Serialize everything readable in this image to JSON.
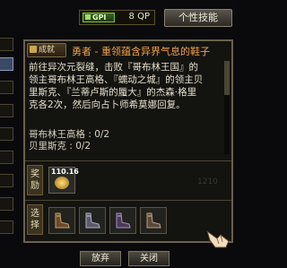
{
  "topbar": {
    "currency_badge": "GPI",
    "currency_amount": "8 QP",
    "skill_button": "个性技能"
  },
  "quest": {
    "tag": "成就",
    "title": "勇者 - 重领蕴含异界气息的鞋子",
    "description_lines": [
      "    前往异次元裂缝，击败『哥布林王国』的",
      "领主哥布林王高格、『蠕动之城』的领主贝",
      "里斯克、『兰蒂卢斯的蜃大』的杰森·格里",
      "克各2次，然后向占卜师希莫娜回复。"
    ],
    "objectives": [
      "哥布林王高格 : 0/2",
      "贝里斯克 : 0/2"
    ]
  },
  "rewards": {
    "label": "奖励",
    "item_qty": "110.16",
    "faint_text": "1210"
  },
  "choose": {
    "label": "选择",
    "item_count": 4
  },
  "buttons": {
    "abandon": "放弃",
    "close": "关闭"
  },
  "colors": {
    "title": "#f2a24a",
    "panel_border": "#6a6150",
    "background": "#0a0a0c"
  }
}
